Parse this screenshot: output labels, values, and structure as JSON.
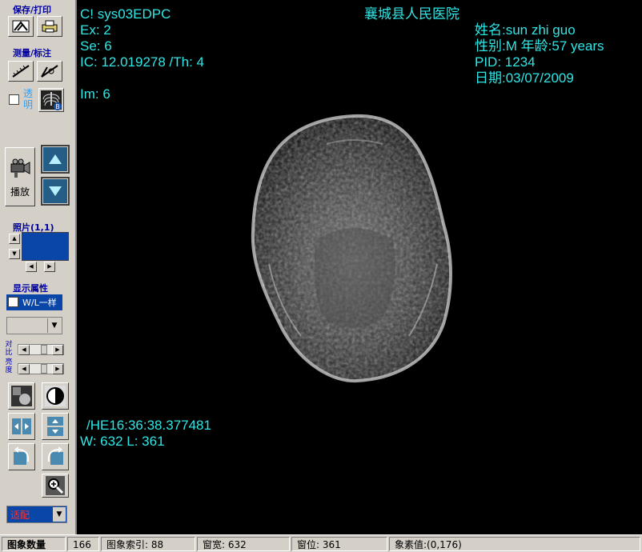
{
  "toolbar": {
    "save_print_title": "保存/打印",
    "measure_title": "测量/标注",
    "transparent_label": "透明",
    "play_label": "播放",
    "photo_label": "照片(1,1)",
    "display_title": "显示属性",
    "wl_same_label": "W/L一样",
    "contrast_label": "对比",
    "brightness_label": "亮度",
    "fit_option": "适配",
    "xray_badge": "B"
  },
  "viewer": {
    "top_left": {
      "line1": "C!  sys03EDPC",
      "line2": "Ex: 2",
      "line3": "Se: 6",
      "line4": "IC: 12.019278 /Th: 4",
      "line5": "Im: 6"
    },
    "hospital": "襄城县人民医院",
    "patient": {
      "name_line": "姓名:sun zhi guo",
      "sex_age_line": "性别:M  年龄:57 years",
      "pid_line": "PID: 1234",
      "date_line": "日期:03/07/2009"
    },
    "bottom_left": {
      "he_line": "/HE16:36:38.377481",
      "wl_line": "W: 632 L: 361"
    }
  },
  "status_bar": {
    "image_count_label": "图象数量",
    "image_count_value": "166",
    "image_index": "图象索引: 88",
    "window_width": "窗宽: 632",
    "window_level": "窗位: 361",
    "pixel_value": "象素值:(0,176)"
  },
  "colors": {
    "overlay_text": "#2fe6e6",
    "accent_blue": "#0a46a8",
    "title_blue": "#0000a0"
  }
}
